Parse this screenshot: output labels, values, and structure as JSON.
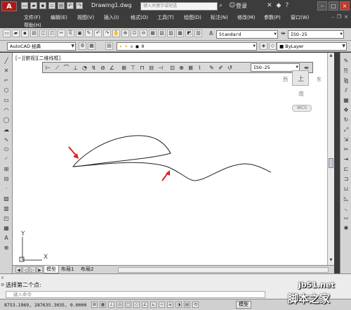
{
  "titlebar": {
    "logo_text": "A",
    "doc_title": "Drawing1.dwg",
    "search_placeholder": "键入关键字或短语",
    "login_label": "登录"
  },
  "menu": {
    "items": [
      "文件(F)",
      "编辑(E)",
      "视图(V)",
      "插入(I)",
      "格式(O)",
      "工具(T)",
      "绘图(D)",
      "标注(N)",
      "修改(M)",
      "参数(P)",
      "窗口(W)"
    ],
    "help": "帮助(H)"
  },
  "toolbar1": {
    "text_style": "Standard",
    "dim_style": "ISO-25"
  },
  "toolbar2": {
    "workspace": "AutoCAD 经典",
    "layer": "0",
    "color": "ByLayer"
  },
  "viewport": {
    "label": "[−][俯视][二维线框]"
  },
  "float_toolbar": {
    "dim_style": "ISO-25"
  },
  "viewcube": {
    "west": "西",
    "east": "东",
    "top": "上",
    "south": "南",
    "wcs": "WCS"
  },
  "ucs": {
    "x": "X",
    "y": "Y"
  },
  "tabs": {
    "model": "模型",
    "layout1": "布局1",
    "layout2": "布局2"
  },
  "command": {
    "history": "选择第二个点:",
    "placeholder": "键入命令"
  },
  "status": {
    "coords": "8753.1969,  287635.3035, 0.0000",
    "model": "模型"
  },
  "watermark": {
    "domain": "jb51.net",
    "name": "脚本之家"
  },
  "colors": {
    "canvas": "#ffffff",
    "arrow": "#e02020",
    "logo": "#b01818"
  }
}
